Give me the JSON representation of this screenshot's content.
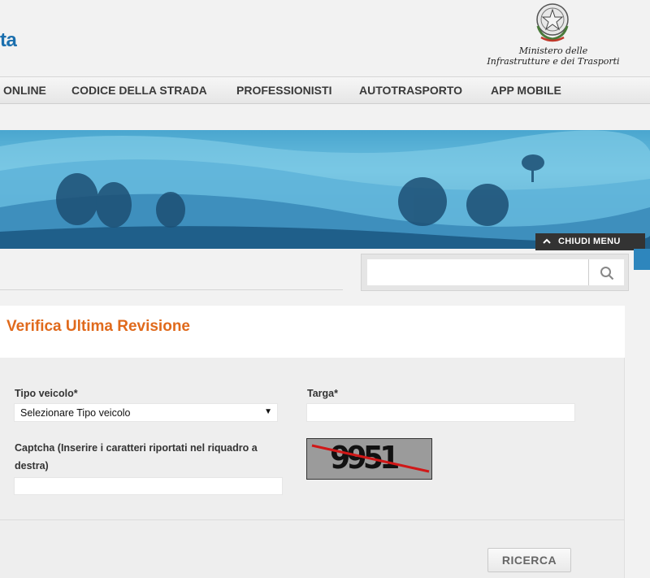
{
  "header": {
    "brand_fragment": "ta",
    "ministry_line1": "Ministero delle",
    "ministry_line2": "Infrastrutture e dei Trasporti"
  },
  "nav": {
    "items": [
      "ONLINE",
      "CODICE DELLA STRADA",
      "PROFESSIONISTI",
      "AUTOTRASPORTO",
      "APP MOBILE"
    ]
  },
  "menu_toggle": {
    "label": "CHIUDI MENU",
    "icon": "chevron-up-icon"
  },
  "site_search": {
    "placeholder": "",
    "value": "",
    "icon": "search-icon"
  },
  "form": {
    "title": "Verifica Ultima Revisione",
    "vehicle_type": {
      "label": "Tipo veicolo*",
      "selected": "Selezionare Tipo veicolo"
    },
    "plate": {
      "label": "Targa*",
      "value": ""
    },
    "captcha": {
      "label": "Captcha (Inserire i caratteri riportati nel riquadro a destra)",
      "value": "",
      "image_text": "9951"
    },
    "submit_label": "RICERCA"
  },
  "colors": {
    "title": "#e06a1c",
    "brand": "#1b6fae",
    "menu_toggle_bg": "#333333"
  }
}
